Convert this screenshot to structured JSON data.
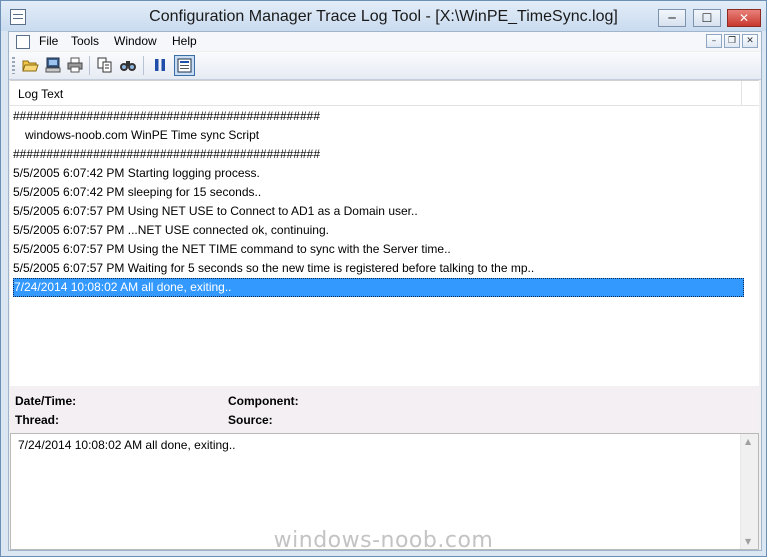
{
  "window": {
    "title": "Configuration Manager Trace Log Tool - [X:\\WinPE_TimeSync.log]",
    "controls": {
      "minimize": "─",
      "maximize": "☐",
      "close": "✕"
    }
  },
  "menubar": {
    "items": [
      "File",
      "Tools",
      "Window",
      "Help"
    ],
    "mdi_controls": {
      "minimize": "–",
      "restore": "❐",
      "close": "✕"
    }
  },
  "toolbar": {
    "buttons": [
      "open-icon",
      "open-on-server-icon",
      "print-icon",
      "copy-icon",
      "find-icon",
      "pause-icon",
      "highlight-icon"
    ]
  },
  "log_list": {
    "column_header": "Log Text",
    "rows": [
      "##############################################",
      "windows-noob.com WinPE Time sync Script",
      "##############################################",
      "5/5/2005 6:07:42 PM Starting logging process.",
      "5/5/2005 6:07:42 PM sleeping for 15 seconds..",
      "5/5/2005 6:07:57 PM Using NET USE to Connect to AD1 as a Domain user..",
      "5/5/2005 6:07:57 PM ...NET USE connected ok, continuing.",
      "5/5/2005 6:07:57 PM Using the NET TIME command to sync with the Server time..",
      "5/5/2005 6:07:57 PM Waiting for 5 seconds so the new time is registered before talking to the mp..",
      "7/24/2014 10:08:02 AM all done, exiting.."
    ],
    "selected_row": 9
  },
  "details": {
    "date_time_label": "Date/Time:",
    "component_label": "Component:",
    "thread_label": "Thread:",
    "source_label": "Source:"
  },
  "message": {
    "text": "7/24/2014 10:08:02 AM all done, exiting.."
  },
  "watermark": "windows-noob.com",
  "colors": {
    "selection": "#3399ff",
    "title_bar": "#dbe6f3",
    "close_button": "#c8392f"
  }
}
